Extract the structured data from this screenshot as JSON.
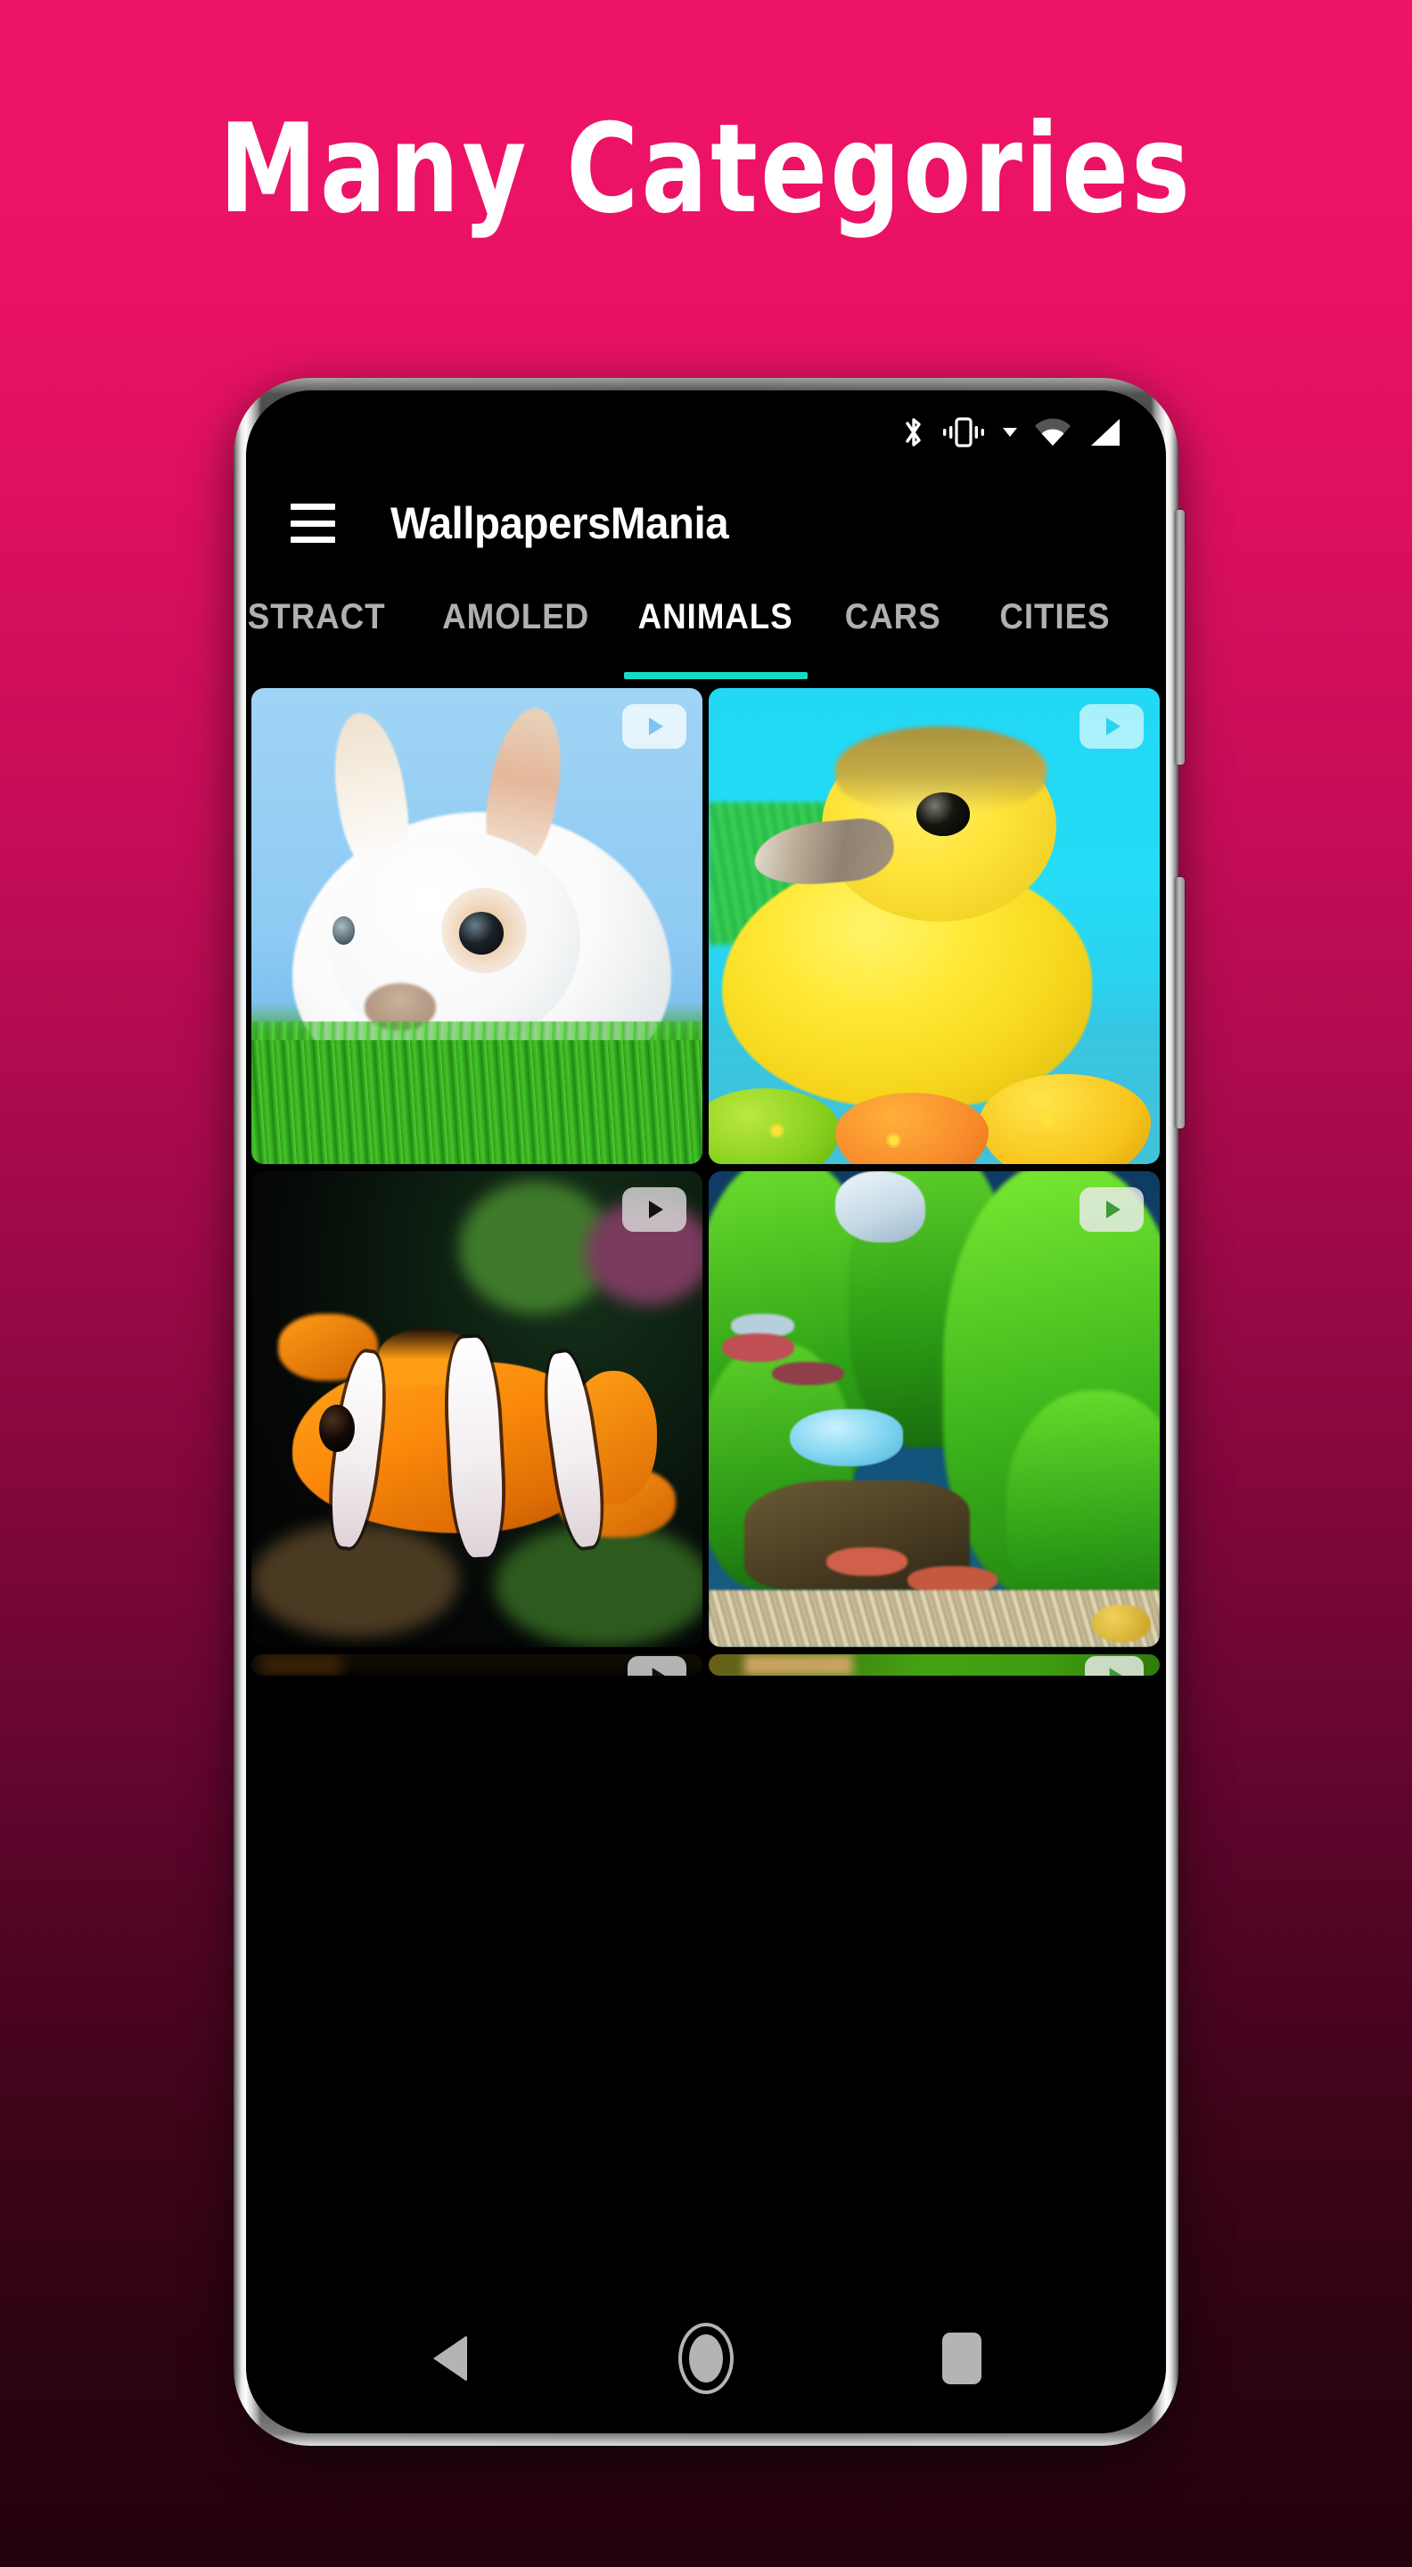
{
  "promo": {
    "headline": "Many Categories",
    "background_top_color": "#ee1568",
    "background_bottom_color": "#240210"
  },
  "device": {
    "bezel_color": "#d9d9d9",
    "screen_background": "#000000",
    "side_buttons": [
      "volume-rocker",
      "power-button"
    ]
  },
  "status_bar": {
    "icons": [
      "bluetooth-icon",
      "vibrate-icon",
      "dropdown-caret-icon",
      "wifi-icon",
      "cellular-signal-icon"
    ]
  },
  "app_bar": {
    "menu_icon": "hamburger-menu-icon",
    "title": "WallpapersMania"
  },
  "tabs": {
    "active_index": 2,
    "accent_color": "#17dcc5",
    "inactive_color": "#b0b0b0",
    "items": [
      {
        "label": "STRACT"
      },
      {
        "label": "AMOLED"
      },
      {
        "label": "ANIMALS"
      },
      {
        "label": "CARS"
      },
      {
        "label": "CITIES"
      }
    ]
  },
  "grid": {
    "play_badge_icon": "play-icon",
    "tiles": [
      {
        "subject": "white-rabbit-in-grass",
        "has_play_badge": true
      },
      {
        "subject": "yellow-duckling-with-easter-eggs",
        "has_play_badge": true
      },
      {
        "subject": "clownfish-in-reef",
        "has_play_badge": true
      },
      {
        "subject": "planted-aquarium-with-fish",
        "has_play_badge": true
      },
      {
        "subject": "dark-wallpaper-partial",
        "has_play_badge": true
      },
      {
        "subject": "green-leaf-wallpaper-partial",
        "has_play_badge": true
      }
    ]
  },
  "nav_bar": {
    "back_label": "Back",
    "home_label": "Home",
    "recents_label": "Recents",
    "icon_color": "#b4b4b4"
  }
}
